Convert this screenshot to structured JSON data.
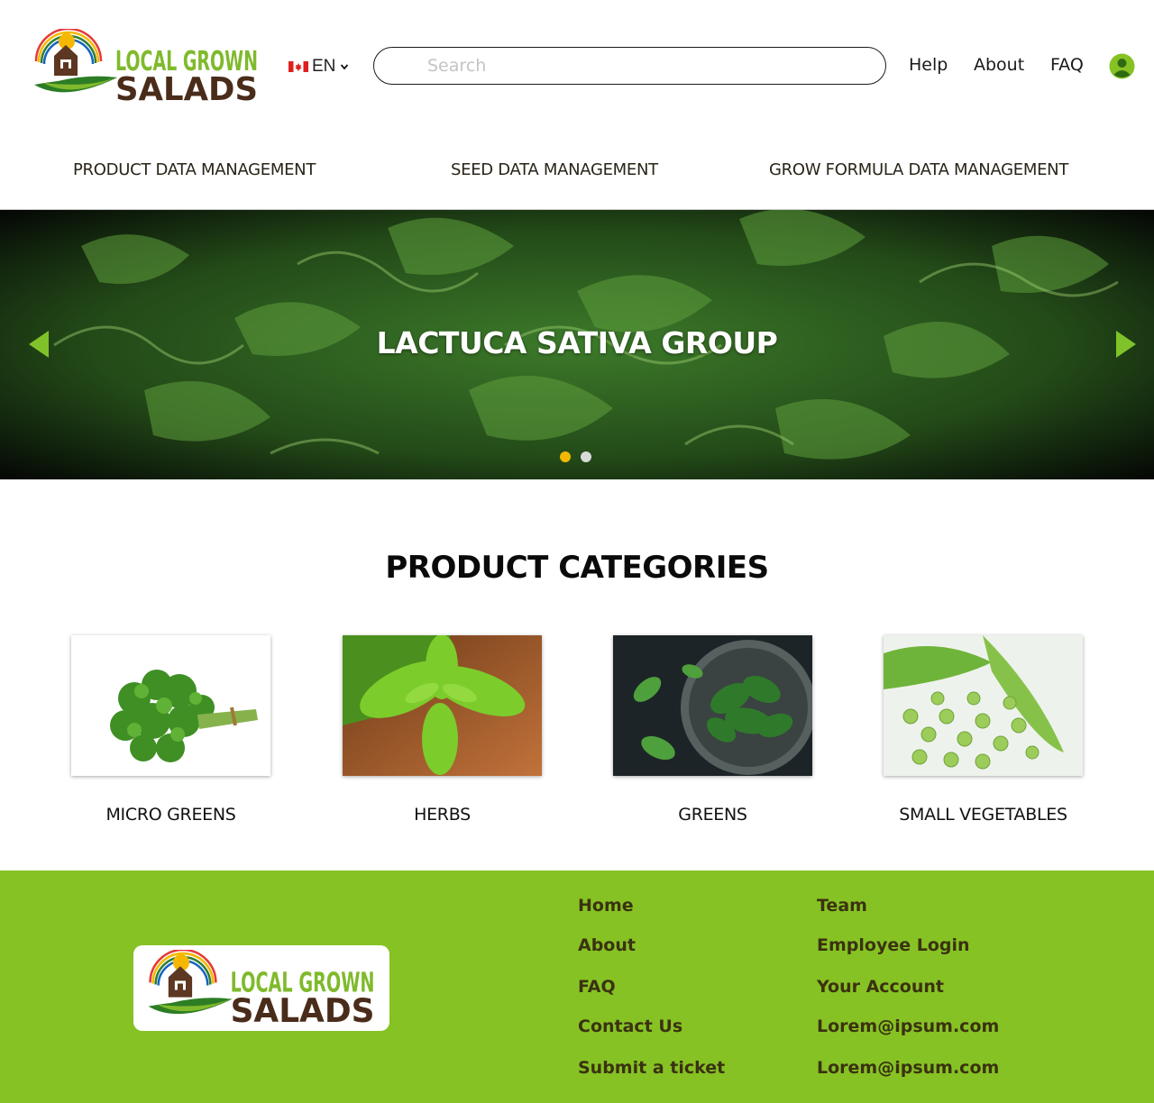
{
  "brand": {
    "name_line1": "LOCAL GROWN",
    "name_line2": "SALADS"
  },
  "header": {
    "language": {
      "code": "EN",
      "flag_icon": "canada-flag-icon"
    },
    "search": {
      "placeholder": "Search",
      "value": ""
    },
    "links": [
      "Help",
      "About",
      "FAQ"
    ],
    "account_icon": "user-avatar-icon"
  },
  "category_nav": [
    "PRODUCT DATA MANAGEMENT",
    "SEED DATA MANAGEMENT",
    "GROW FORMULA DATA MANAGEMENT"
  ],
  "hero": {
    "title": "LACTUCA SATIVA GROUP",
    "slide_count": 2,
    "active_slide": 1,
    "arrow_icons": [
      "triangle-left-icon",
      "triangle-right-icon"
    ]
  },
  "product_categories": {
    "title": "PRODUCT CATEGORIES",
    "items": [
      {
        "label": "MICRO GREENS",
        "image": "parsley-bunch-photo"
      },
      {
        "label": "HERBS",
        "image": "basil-plant-photo"
      },
      {
        "label": "GREENS",
        "image": "spinach-colander-photo"
      },
      {
        "label": "SMALL VEGETABLES",
        "image": "green-peas-photo"
      }
    ]
  },
  "footer": {
    "col1": [
      "Home",
      "About",
      "FAQ",
      "Contact Us",
      "Submit a ticket"
    ],
    "col2": [
      "Team",
      "Employee Login",
      "Your Account",
      "Lorem@ipsum.com",
      "Lorem@ipsum.com"
    ]
  },
  "colors": {
    "accent_green": "#86c224",
    "logo_green": "#7fba2c",
    "logo_brown": "#4a2c1a",
    "active_dot": "#f2b705",
    "inactive_dot": "#d9d9d9",
    "footer_text": "#3a3210"
  }
}
